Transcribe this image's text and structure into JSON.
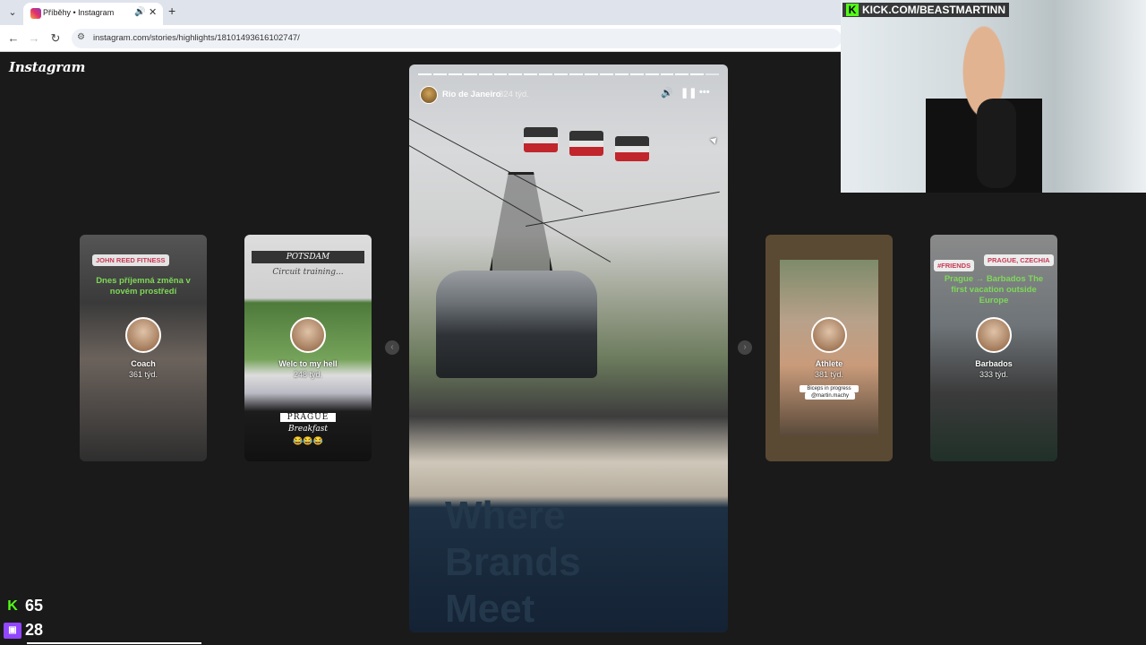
{
  "browser": {
    "tab": {
      "title": "Příběhy • Instagram",
      "audio_icon": "speaker-icon",
      "close_icon": "close-icon"
    },
    "new_tab_label": "+",
    "url": "instagram.com/stories/highlights/18101493616102747/"
  },
  "instagram": {
    "logo": "Instagram",
    "story": {
      "name": "Rio de Janeiro",
      "age": "324 týd.",
      "segments_total": 20,
      "segments_done": 19,
      "sign_text": [
        "Where",
        "Brands",
        "Meet"
      ]
    },
    "cards": [
      {
        "name": "Coach",
        "age": "361 týd.",
        "chip": "JOHN REED FITNESS",
        "overlay": "Dnes příjemná změna v novém prostředí"
      },
      {
        "name": "Welc to my hell",
        "age": "248 týd.",
        "title_box": "POTSDAM",
        "subtitle": "Circuit training...",
        "prague": "PRAGUE",
        "breakfast": "Breakfast",
        "emoji": "😂😂😂"
      },
      {
        "name": "Athlete",
        "age": "381 týd.",
        "caption": "Biceps in progress",
        "handle": "@martin.machy"
      },
      {
        "name": "Barbados",
        "age": "333 týd.",
        "chip_left": "#FRIENDS",
        "chip_right": "PRAGUE, CZECHIA",
        "overlay": "Prague → Barbados The first vacation outside Europe"
      }
    ]
  },
  "stream": {
    "kick_url": "KICK.COM/BEASTMARTINN",
    "kick_viewers": "65",
    "twitch_viewers": "28"
  },
  "colors": {
    "kick_green": "#53fc18",
    "twitch_purple": "#9146ff",
    "background": "#1a1a1a"
  }
}
